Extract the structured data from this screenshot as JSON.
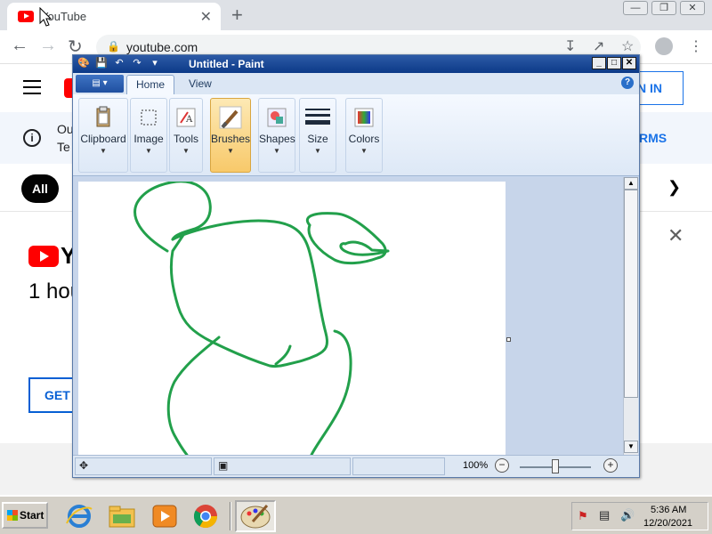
{
  "browser": {
    "tab_title": "YouTube",
    "tab_close": "✕",
    "new_tab": "+",
    "url": "youtube.com",
    "window_buttons": [
      "—",
      "❐",
      "✕"
    ]
  },
  "youtube": {
    "signin_label": "N IN",
    "banner_line1": "Ou",
    "banner_line2": "Te",
    "banner_action": "RMS",
    "chip_all": "All",
    "promo_logo_text": "Y",
    "promo_text": "1 hou",
    "get_button": "GET"
  },
  "paint": {
    "title": "Untitled - Paint",
    "tabs": [
      "Home",
      "View"
    ],
    "groups": [
      "Clipboard",
      "Image",
      "Tools",
      "Brushes",
      "Shapes",
      "Size",
      "Colors"
    ],
    "zoom": "100%",
    "zoom_value": 100,
    "stroke_color": "#22a04b"
  },
  "taskbar": {
    "start_label": "Start",
    "time": "5:36 AM",
    "date": "12/20/2021"
  }
}
